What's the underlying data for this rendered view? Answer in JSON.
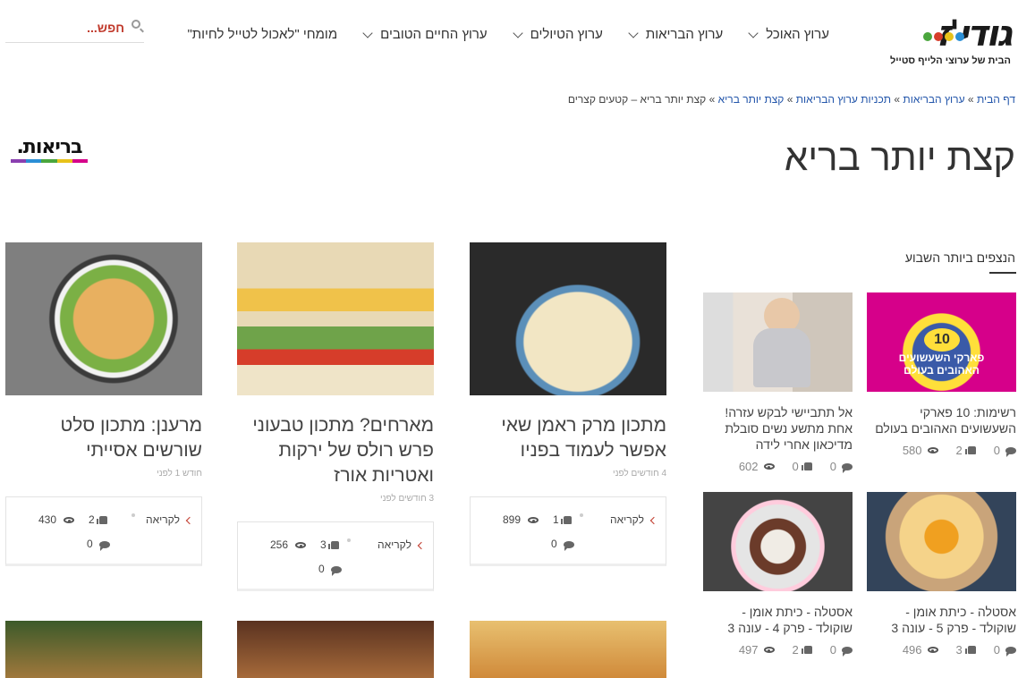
{
  "logo": {
    "word": "גודי'ז",
    "tagline": "הבית של ערוצי הלייף סטייל"
  },
  "nav": {
    "items": [
      {
        "label": "ערוץ האוכל",
        "has_dropdown": true
      },
      {
        "label": "ערוץ הבריאות",
        "has_dropdown": true
      },
      {
        "label": "ערוץ הטיולים",
        "has_dropdown": true
      },
      {
        "label": "ערוץ החיים הטובים",
        "has_dropdown": true
      },
      {
        "label": "מומחי \"לאכול לטייל לחיות\"",
        "has_dropdown": false
      }
    ]
  },
  "search": {
    "placeholder": "חפש..."
  },
  "breadcrumb": {
    "home": "דף הבית",
    "channel": "ערוץ הבריאות",
    "programs": "תכניות ערוץ הבריאות",
    "show": "קצת יותר בריא",
    "current": "קצת יותר בריא – קטעים קצרים",
    "sep": "»"
  },
  "page_title": "קצת יותר בריא",
  "section_logo": {
    "text": "בריאות."
  },
  "sidebar": {
    "title": "הנצפים ביותר השבוע",
    "items": [
      {
        "title": "רשימות: 10 פארקי השעשועים האהובים בעולם",
        "comments": "0",
        "likes": "2",
        "views": "580",
        "img_caption": "פארקי השעשועים האהובים בעולם",
        "img_num": "10"
      },
      {
        "title": "אל תתביישי לבקש עזרה! אחת מתשע נשים סובלת מדיכאון אחרי לידה",
        "comments": "0",
        "likes": "0",
        "views": "602"
      },
      {
        "title": "אסטלה - כיתת אומן - שוקולד - פרק 5 - עונה 3",
        "comments": "0",
        "likes": "3",
        "views": "496"
      },
      {
        "title": "אסטלה - כיתת אומן - שוקולד - פרק 4 - עונה 3",
        "comments": "0",
        "likes": "2",
        "views": "497"
      }
    ]
  },
  "cards": [
    {
      "title": "מתכון מרק ראמן שאי אפשר לעמוד בפניו",
      "date": "4 חודשים לפני",
      "read_more": "לקריאה",
      "likes": "1",
      "views": "899",
      "comments": "0"
    },
    {
      "title": "מארחים? מתכון טבעוני פרש רולס של ירקות ואטריות אורז",
      "date": "3 חודשים לפני",
      "read_more": "לקריאה",
      "likes": "3",
      "views": "256",
      "comments": "0"
    },
    {
      "title": "מרענן: מתכון סלט שורשים אסייתי",
      "date": "חודש 1 לפני",
      "read_more": "לקריאה",
      "likes": "2",
      "views": "430",
      "comments": "0"
    }
  ],
  "colors": {
    "accent_red": "#c0392b",
    "link_blue": "#2255aa"
  }
}
